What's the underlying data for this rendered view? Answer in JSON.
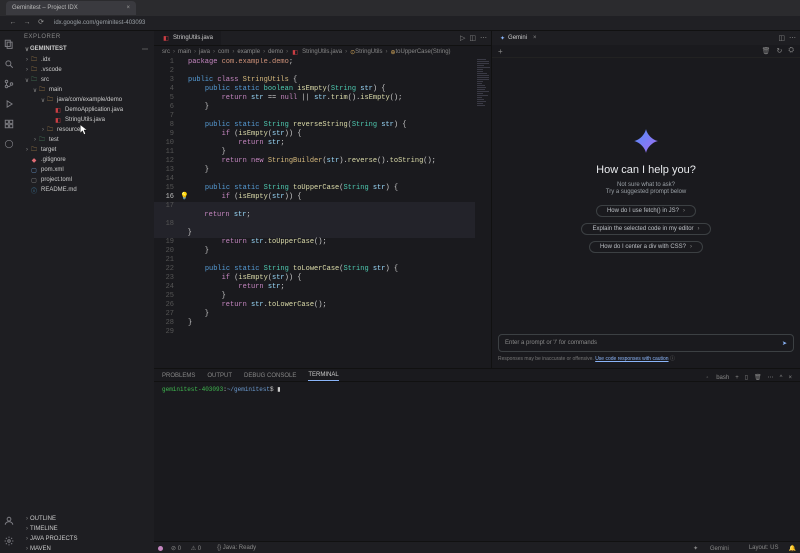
{
  "browser": {
    "tab_title": "Geminitest – Project IDX",
    "url": "idx.google.com/geminitest-403093"
  },
  "sidebar": {
    "title": "EXPLORER",
    "project": "GEMINITEST",
    "tree": {
      "idx": ".idx",
      "vscode": ".vscode",
      "src": "src",
      "main": "main",
      "pkg": "java/com/example/demo",
      "demoapp": "DemoApplication.java",
      "stringutils": "StringUtils.java",
      "resources": "resources",
      "test": "test",
      "target": "target",
      "gitignore": ".gitignore",
      "pom": "pom.xml",
      "projecttoml": "project.toml",
      "readme": "README.md"
    },
    "sections": {
      "outline": "OUTLINE",
      "timeline": "TIMELINE",
      "javaprojects": "JAVA PROJECTS",
      "maven": "MAVEN"
    }
  },
  "editor": {
    "tab": "StringUtils.java",
    "crumbs": {
      "c1": "src",
      "c2": "main",
      "c3": "java",
      "c4": "com",
      "c5": "example",
      "c6": "demo",
      "c7": "StringUtils.java",
      "c8": "StringUtils",
      "c9": "toUpperCase(String)"
    },
    "package_line": "package com.example.demo;",
    "minimap_lines": 24
  },
  "gemini": {
    "tab": "Gemini",
    "title": "How can I help you?",
    "subtitle1": "Not sure what to ask?",
    "subtitle2": "Try a suggested prompt below",
    "pill1": "How do I use fetch() in JS?",
    "pill2": "Explain the selected code in my editor",
    "pill3": "How do I center a div with CSS?",
    "placeholder": "Enter a prompt or '/' for commands",
    "disclaimer": "Responses may be inaccurate or offensive.",
    "disclaimer_link": "Use code responses with caution"
  },
  "panel": {
    "tabs": {
      "problems": "PROBLEMS",
      "output": "OUTPUT",
      "debug": "DEBUG CONSOLE",
      "terminal": "TERMINAL"
    },
    "shell": "bash",
    "prompt_user": "geminitest-403093",
    "prompt_path": "~/geminitest",
    "prompt_suffix": "$"
  },
  "status": {
    "errors": "0",
    "warnings": "0",
    "java": "Java: Ready",
    "gemini": "Gemini",
    "layout": "Layout: US"
  }
}
